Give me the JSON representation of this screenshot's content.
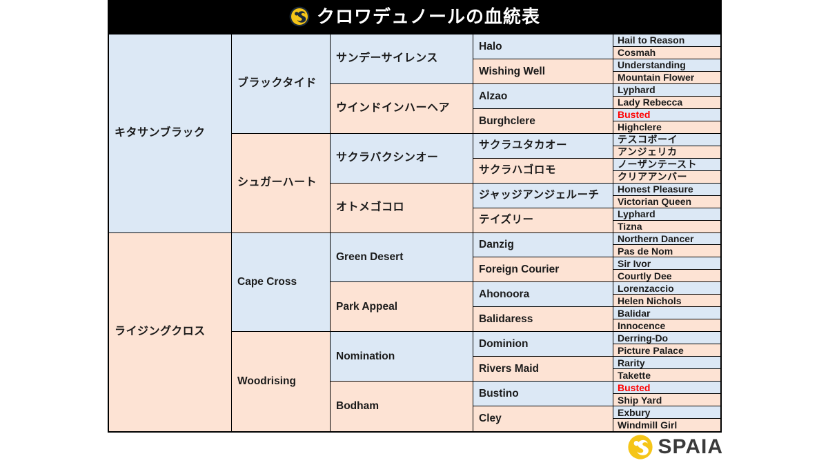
{
  "header": {
    "title": "クロワデュノールの血統表",
    "logo_icon": "spaia-swirl-logo-icon",
    "background_color": "#000000",
    "text_color": "#ffffff"
  },
  "colors": {
    "sire_blue": "#dce8f5",
    "dam_pink": "#fde3d4",
    "inbreed_red": "#ff0000",
    "border": "#000000",
    "brand_gold": "#f5c518"
  },
  "footer": {
    "brand_name": "SPAIA",
    "brand_logo_icon": "spaia-swirl-logo-icon"
  },
  "pedigree": {
    "gen1": [
      {
        "name": "キタサンブラック",
        "sex": "m"
      },
      {
        "name": "ライジングクロス",
        "sex": "f"
      }
    ],
    "gen2": [
      {
        "name": "ブラックタイド",
        "sex": "m"
      },
      {
        "name": "シュガーハート",
        "sex": "f"
      },
      {
        "name": "Cape Cross",
        "sex": "m"
      },
      {
        "name": "Woodrising",
        "sex": "f"
      }
    ],
    "gen3": [
      {
        "name": "サンデーサイレンス",
        "sex": "m"
      },
      {
        "name": "ウインドインハーヘア",
        "sex": "f"
      },
      {
        "name": "サクラバクシンオー",
        "sex": "m"
      },
      {
        "name": "オトメゴコロ",
        "sex": "f"
      },
      {
        "name": "Green Desert",
        "sex": "m"
      },
      {
        "name": "Park Appeal",
        "sex": "f"
      },
      {
        "name": "Nomination",
        "sex": "m"
      },
      {
        "name": "Bodham",
        "sex": "f"
      }
    ],
    "gen4": [
      {
        "name": "Halo",
        "sex": "m"
      },
      {
        "name": "Wishing Well",
        "sex": "f"
      },
      {
        "name": "Alzao",
        "sex": "m"
      },
      {
        "name": "Burghclere",
        "sex": "f"
      },
      {
        "name": "サクラユタカオー",
        "sex": "m"
      },
      {
        "name": "サクラハゴロモ",
        "sex": "f"
      },
      {
        "name": "ジャッジアンジェルーチ",
        "sex": "m"
      },
      {
        "name": "テイズリー",
        "sex": "f"
      },
      {
        "name": "Danzig",
        "sex": "m"
      },
      {
        "name": "Foreign Courier",
        "sex": "f"
      },
      {
        "name": "Ahonoora",
        "sex": "m"
      },
      {
        "name": "Balidaress",
        "sex": "f"
      },
      {
        "name": "Dominion",
        "sex": "m"
      },
      {
        "name": "Rivers Maid",
        "sex": "f"
      },
      {
        "name": "Bustino",
        "sex": "m"
      },
      {
        "name": "Cley",
        "sex": "f"
      }
    ],
    "gen5": [
      {
        "name": "Hail to Reason",
        "sex": "m",
        "inbred": false
      },
      {
        "name": "Cosmah",
        "sex": "f",
        "inbred": false
      },
      {
        "name": "Understanding",
        "sex": "m",
        "inbred": false
      },
      {
        "name": "Mountain Flower",
        "sex": "f",
        "inbred": false
      },
      {
        "name": "Lyphard",
        "sex": "m",
        "inbred": false
      },
      {
        "name": "Lady Rebecca",
        "sex": "f",
        "inbred": false
      },
      {
        "name": "Busted",
        "sex": "m",
        "inbred": true
      },
      {
        "name": "Highclere",
        "sex": "f",
        "inbred": false
      },
      {
        "name": "テスコボーイ",
        "sex": "m",
        "inbred": false
      },
      {
        "name": "アンジェリカ",
        "sex": "f",
        "inbred": false
      },
      {
        "name": "ノーザンテースト",
        "sex": "m",
        "inbred": false
      },
      {
        "name": "クリアアンバー",
        "sex": "f",
        "inbred": false
      },
      {
        "name": "Honest Pleasure",
        "sex": "m",
        "inbred": false
      },
      {
        "name": "Victorian Queen",
        "sex": "f",
        "inbred": false
      },
      {
        "name": "Lyphard",
        "sex": "m",
        "inbred": false
      },
      {
        "name": "Tizna",
        "sex": "f",
        "inbred": false
      },
      {
        "name": "Northern Dancer",
        "sex": "m",
        "inbred": false
      },
      {
        "name": "Pas de Nom",
        "sex": "f",
        "inbred": false
      },
      {
        "name": "Sir Ivor",
        "sex": "m",
        "inbred": false
      },
      {
        "name": "Courtly Dee",
        "sex": "f",
        "inbred": false
      },
      {
        "name": "Lorenzaccio",
        "sex": "m",
        "inbred": false
      },
      {
        "name": "Helen Nichols",
        "sex": "f",
        "inbred": false
      },
      {
        "name": "Balidar",
        "sex": "m",
        "inbred": false
      },
      {
        "name": "Innocence",
        "sex": "f",
        "inbred": false
      },
      {
        "name": "Derring-Do",
        "sex": "m",
        "inbred": false
      },
      {
        "name": "Picture Palace",
        "sex": "f",
        "inbred": false
      },
      {
        "name": "Rarity",
        "sex": "m",
        "inbred": false
      },
      {
        "name": "Takette",
        "sex": "f",
        "inbred": false
      },
      {
        "name": "Busted",
        "sex": "m",
        "inbred": true
      },
      {
        "name": "Ship Yard",
        "sex": "f",
        "inbred": false
      },
      {
        "name": "Exbury",
        "sex": "m",
        "inbred": false
      },
      {
        "name": "Windmill Girl",
        "sex": "f",
        "inbred": false
      }
    ]
  }
}
